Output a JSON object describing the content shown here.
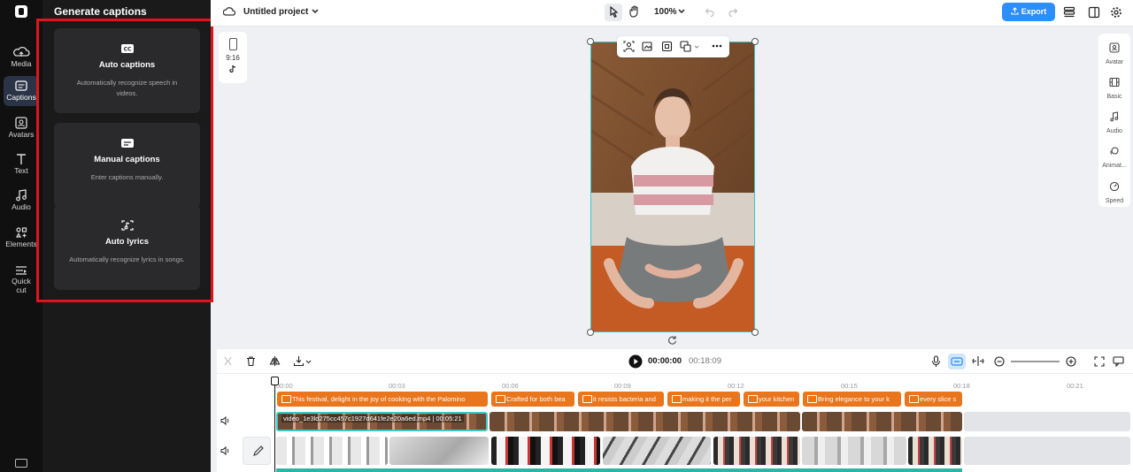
{
  "rail": {
    "items": [
      {
        "label": "Media"
      },
      {
        "label": "Captions"
      },
      {
        "label": "Avatars"
      },
      {
        "label": "Text"
      },
      {
        "label": "Audio"
      },
      {
        "label": "Elements"
      },
      {
        "label": "Quick cut"
      }
    ]
  },
  "panel": {
    "title": "Generate captions",
    "cards": [
      {
        "title": "Auto captions",
        "desc": "Automatically recognize speech in videos."
      },
      {
        "title": "Manual captions",
        "desc": "Enter captions manually."
      },
      {
        "title": "Auto lyrics",
        "desc": "Automatically recognize lyrics in songs."
      }
    ]
  },
  "topbar": {
    "project_title": "Untitled project",
    "zoom": "100%",
    "export_label": "Export"
  },
  "aspect": {
    "ratio": "9:16"
  },
  "right_panel": {
    "items": [
      {
        "label": "Avatar"
      },
      {
        "label": "Basic"
      },
      {
        "label": "Audio"
      },
      {
        "label": "Animat..."
      },
      {
        "label": "Speed"
      }
    ]
  },
  "timeline": {
    "current_time": "00:00:00",
    "total_time": "00:18:09",
    "ruler": [
      "00:00",
      "00:03",
      "00:06",
      "00:09",
      "00:12",
      "00:15",
      "00:18",
      "00:21"
    ],
    "captions": [
      "This festival, delight in the joy of cooking with the Palomino",
      "Crafted for both bea",
      "it resists bacteria and",
      "making it the per",
      "your kitchen",
      "Bring elegance to your k",
      "every slice s"
    ],
    "video_clip_label": "video_1e3ld275cc457c1927d641fe2e20a6ed.mp4 | 00:05:21"
  },
  "colors": {
    "accent": "#2c8ef8",
    "caption_orange": "#e9751c",
    "selection_teal": "#3ec5c5",
    "highlight_red": "#e0141c"
  }
}
